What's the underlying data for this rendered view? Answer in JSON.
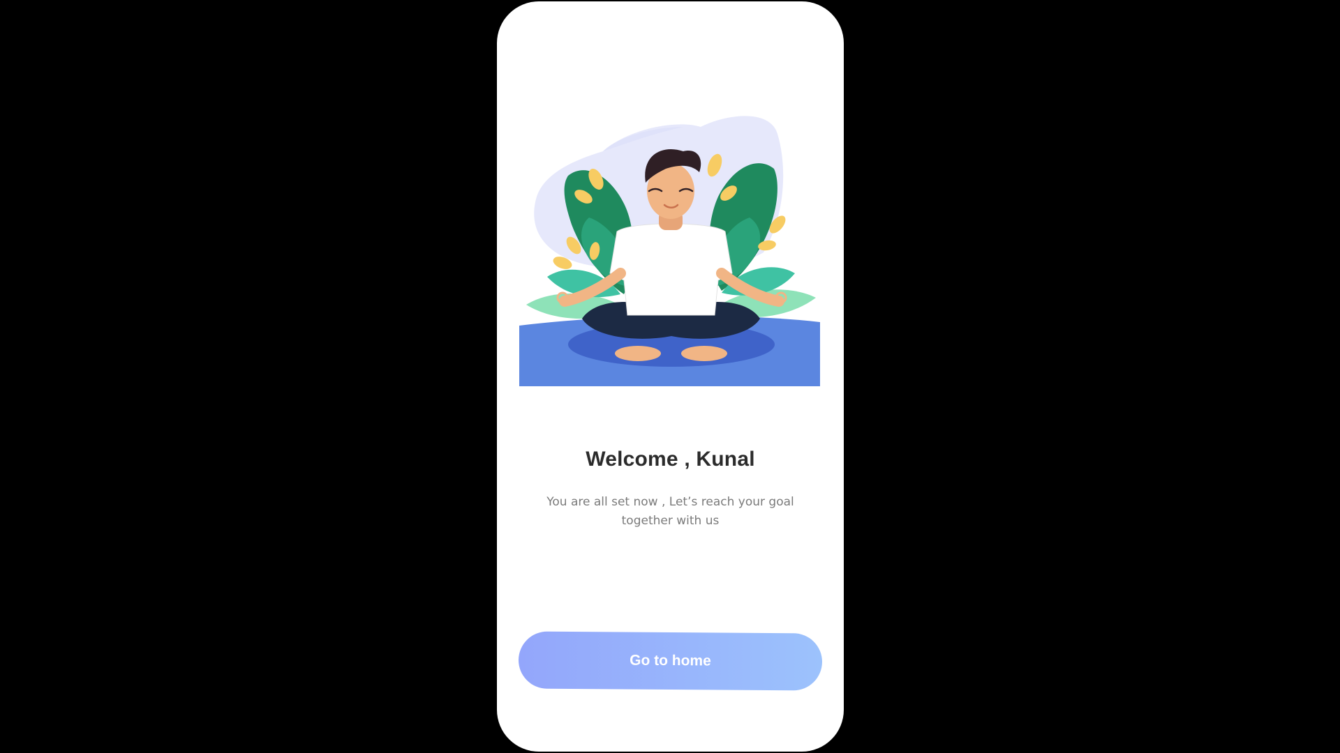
{
  "welcome": {
    "title": "Welcome , Kunal",
    "subtitle": "You are all set now , Let’s reach your goal together with us"
  },
  "illustration": {
    "icon": "meditation-illustration"
  },
  "actions": {
    "go_home_label": "Go to home"
  },
  "colors": {
    "background": "#000000",
    "card": "#ffffff",
    "button_gradient_start": "#93a6fb",
    "button_gradient_end": "#9cc2fc",
    "title": "#2b2b2b",
    "subtitle": "#7a7a7a"
  }
}
